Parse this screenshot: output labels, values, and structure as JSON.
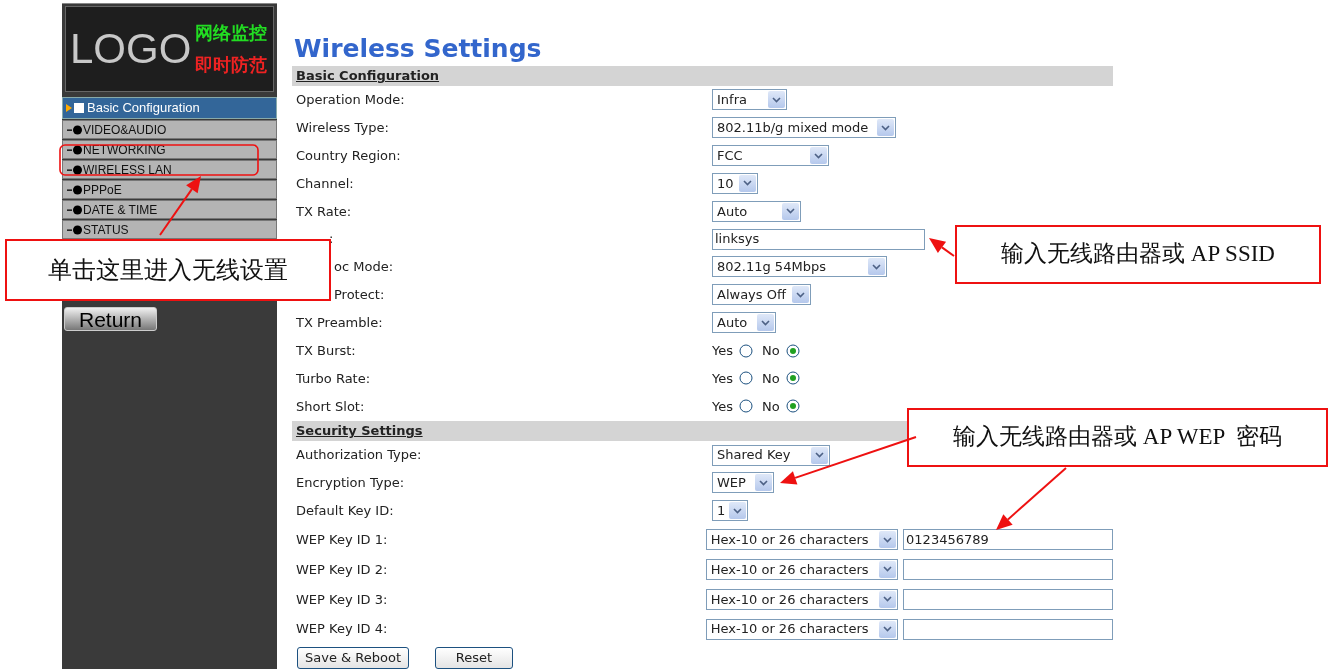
{
  "sidebar": {
    "logo": {
      "text": "LOGO",
      "line_1": "网络监控",
      "line_2": "即时防范"
    },
    "items": [
      {
        "label": "Basic Configuration",
        "selected": true
      },
      {
        "label": "VIDEO&AUDIO",
        "selected": false
      },
      {
        "label": "NETWORKING",
        "selected": false
      },
      {
        "label": "WIRELESS LAN",
        "selected": false
      },
      {
        "label": "PPPoE",
        "selected": false
      },
      {
        "label": "DATE & TIME",
        "selected": false
      },
      {
        "label": "STATUS",
        "selected": false
      }
    ],
    "return_button": "Return"
  },
  "page_title": "Wireless Settings",
  "sections": [
    {
      "heading": "Basic Configuration",
      "rows": [
        {
          "label": "Operation Mode:",
          "kind": "select",
          "value": "Infra"
        },
        {
          "label": "Wireless Type:",
          "kind": "select",
          "value": "802.11b/g mixed mode"
        },
        {
          "label": "Country Region:",
          "kind": "select",
          "value": "FCC"
        },
        {
          "label": "Channel:",
          "kind": "select",
          "value": "10"
        },
        {
          "label": "TX Rate:",
          "kind": "select",
          "value": "Auto"
        },
        {
          "label": ":",
          "kind": "input",
          "value": "linksys"
        },
        {
          "label": "oc Mode:",
          "kind": "select",
          "value": "802.11g 54Mbps"
        },
        {
          "label": "Protect:",
          "kind": "select",
          "value": "Always Off"
        },
        {
          "label": "TX Preamble:",
          "kind": "select",
          "value": "Auto"
        },
        {
          "label": "TX Burst:",
          "kind": "radio",
          "options": [
            {
              "label": "Yes",
              "selected": false
            },
            {
              "label": "No",
              "selected": true
            }
          ]
        },
        {
          "label": "Turbo Rate:",
          "kind": "radio",
          "options": [
            {
              "label": "Yes",
              "selected": false
            },
            {
              "label": "No",
              "selected": true
            }
          ]
        },
        {
          "label": "Short Slot:",
          "kind": "radio",
          "options": [
            {
              "label": "Yes",
              "selected": false
            },
            {
              "label": "No",
              "selected": true
            }
          ]
        }
      ]
    },
    {
      "heading": "Security Settings",
      "rows": [
        {
          "label": "Authorization Type:",
          "kind": "select",
          "value": "Shared Key"
        },
        {
          "label": "Encryption Type:",
          "kind": "select",
          "value": "WEP"
        },
        {
          "label": "Default Key ID:",
          "kind": "select",
          "value": "1"
        },
        {
          "label": "WEP Key ID 1:",
          "kind": "key",
          "value": "Hex-10 or 26 characters",
          "key": "0123456789"
        },
        {
          "label": "WEP Key ID 2:",
          "kind": "key",
          "value": "Hex-10 or 26 characters"
        },
        {
          "label": "WEP Key ID 3:",
          "kind": "key",
          "value": "Hex-10 or 26 characters"
        },
        {
          "label": "WEP Key ID 4:",
          "kind": "key",
          "value": "Hex-10 or 26 characters"
        }
      ]
    }
  ],
  "buttons": [
    "Save & Reboot",
    "Reset"
  ],
  "annotations": [
    {
      "text": "单击这里进入无线设置"
    },
    {
      "text": "输入无线路由器或 AP SSID"
    },
    {
      "text": "输入无线路由器或 AP WEP  密码"
    }
  ]
}
